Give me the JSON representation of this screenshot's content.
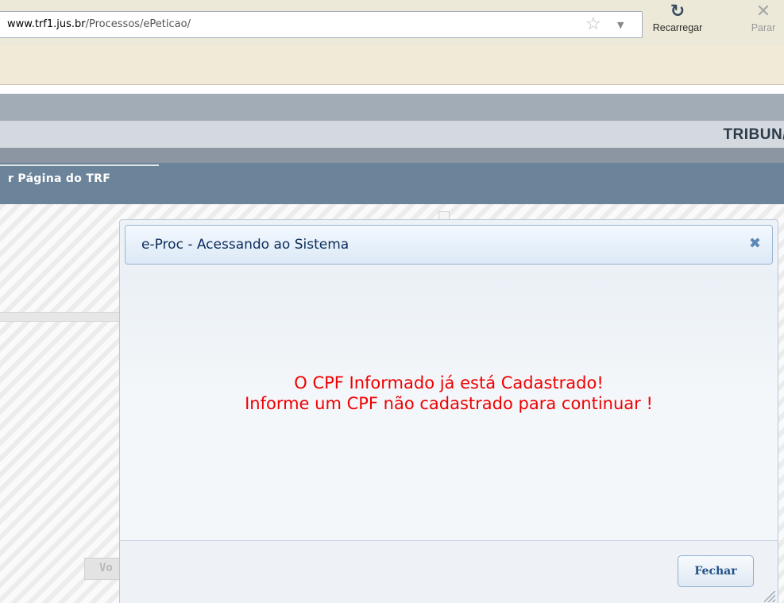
{
  "browser": {
    "url_host": "www.trf1.jus.br",
    "url_path": "/Processos/ePeticao/",
    "reload_label": "Recarregar",
    "stop_label": "Parar",
    "icons": [
      "star-icon",
      "dropdown-icon",
      "reload-icon",
      "stop-icon"
    ]
  },
  "site": {
    "header_title": "TRIBUN/",
    "menu_item": "r  Página do TRF",
    "background_button_fragment": "Vo"
  },
  "dialog": {
    "title": "e-Proc - Acessando ao Sistema",
    "message_line1": "O CPF Informado já está Cadastrado!",
    "message_line2": "Informe um CPF não cadastrado para continuar !",
    "close_button": "Fechar"
  },
  "colors": {
    "message_text": "#ef0000",
    "dialog_title_text": "#0a2b5d",
    "menu_bar": "#6b8499",
    "button_text": "#204f86"
  }
}
